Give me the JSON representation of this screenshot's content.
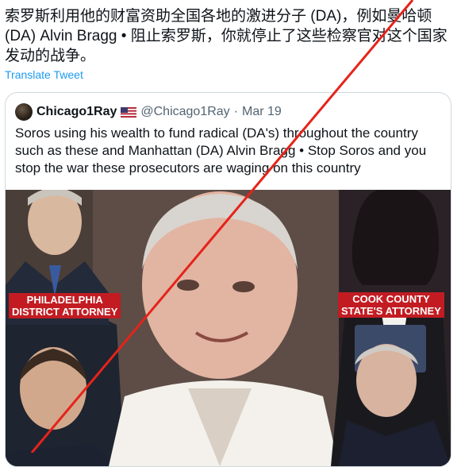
{
  "tweet": {
    "text": "索罗斯利用他的财富资助全国各地的激进分子 (DA)，例如曼哈顿 (DA) Alvin Bragg • 阻止索罗斯，你就停止了这些检察官对这个国家发动的战争。",
    "translate_label": "Translate Tweet"
  },
  "quote": {
    "author_name": "Chicago1Ray",
    "handle": "@Chicago1Ray",
    "separator": "·",
    "date": "Mar 19",
    "text": "Soros using his wealth to fund radical (DA's) throughout the country such as these and Manhattan (DA) Alvin Bragg • Stop Soros and you stop the war these prosecutors are waging on this country",
    "icons": {
      "avatar": "profile-avatar",
      "flag": "us-flag-icon"
    }
  },
  "image": {
    "label_left_line1": "PHILADELPHIA",
    "label_left_line2": "DISTRICT ATTORNEY",
    "label_right_line1": "COOK COUNTY",
    "label_right_line2": "STATE'S ATTORNEY",
    "overlay_color": "#e5231b"
  }
}
